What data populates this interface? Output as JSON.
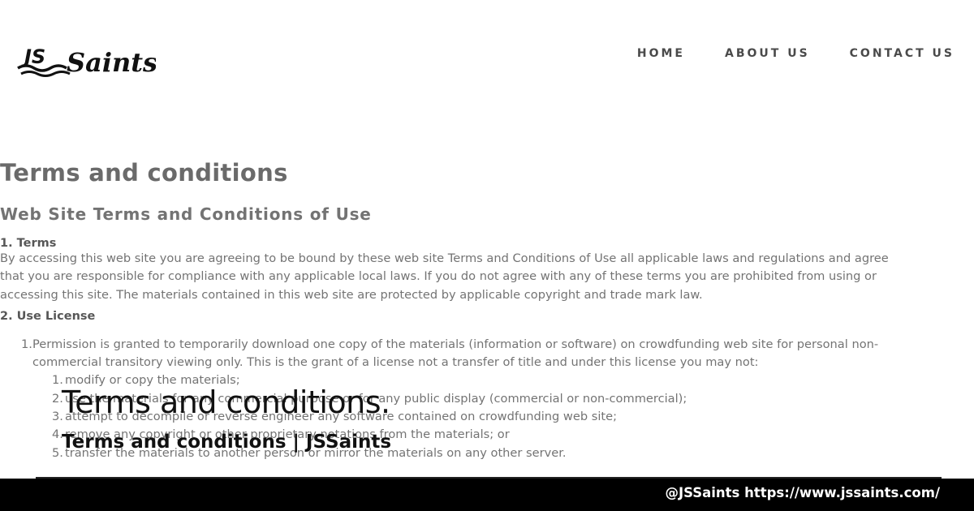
{
  "header": {
    "logo_text": "JS Saints",
    "nav": [
      "HOME",
      "ABOUT US",
      "CONTACT US"
    ]
  },
  "page": {
    "heading": "Terms and conditions",
    "subheading": "Web Site Terms and Conditions of Use",
    "section1": {
      "title": "1. Terms",
      "paragraph_lines": [
        "By accessing this web site you are agreeing to be bound by these web site Terms and Conditions of Use all applicable laws and regulations and agree",
        "that you are responsible for compliance with any applicable local laws. If you do not agree with any of these terms you are prohibited from using or",
        "accessing this site. The materials contained in this web site are protected by applicable copyright and trade mark law."
      ]
    },
    "section2": {
      "title": "2. Use License",
      "item1_number": "1.",
      "item1_lines": [
        "Permission is granted to temporarily download one copy of the materials (information or software) on crowdfunding web site for personal non-",
        "commercial transitory viewing only. This is the grant of a license not a transfer of title and under this license you may not:"
      ],
      "subitems": [
        {
          "number": "1.",
          "text": "modify or copy the materials;"
        },
        {
          "number": "2.",
          "text": "use the materials for any commercial purpose or for any public display (commercial or non-commercial);"
        },
        {
          "number": "3.",
          "text": "attempt to decompile or reverse engineer any software contained on crowdfunding web site;"
        },
        {
          "number": "4.",
          "text": "remove any copyright or other proprietary notations from the materials; or"
        },
        {
          "number": "5.",
          "text": "transfer the materials to another person or mirror the materials on any other server."
        }
      ]
    }
  },
  "overlay": {
    "title": "Terms and conditions.",
    "subtitle": "Terms and conditions | JSSaints"
  },
  "footer": {
    "handle": "@JSSaints https://www.jssaints.com/"
  },
  "colors": {
    "nav_text": "#4a4a4a",
    "bar": "#000000",
    "bar_text": "#ffffff"
  }
}
